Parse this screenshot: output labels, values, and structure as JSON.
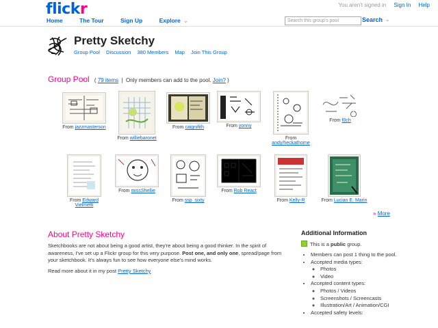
{
  "brand": {
    "part1": "flick",
    "part2": "r"
  },
  "topbar": {
    "status": "You aren't signed in",
    "sign_in": "Sign In",
    "help": "Help"
  },
  "nav": {
    "home": "Home",
    "tour": "The Tour",
    "signup": "Sign Up",
    "explore": "Explore"
  },
  "search": {
    "placeholder": "Search this group's pool",
    "button": "Search"
  },
  "group": {
    "title": "Pretty Sketchy",
    "tabs": [
      "Group Pool",
      "Discussion",
      "380 Members",
      "Map",
      "Join This Group"
    ]
  },
  "pool": {
    "title": "Group Pool",
    "items_link": "79 items",
    "note": "Only members can add to the pool.",
    "join_link": "Join?",
    "from_label": "From",
    "thumbs": [
      {
        "name": "jazzmasterson"
      },
      {
        "name": "williebaronet"
      },
      {
        "name": "caignifith"
      },
      {
        "name": "yonny"
      },
      {
        "name": "andy/heckathorne"
      },
      {
        "name": "f0ch"
      },
      {
        "name": "Edward Vielmetti"
      },
      {
        "name": "missShellie"
      },
      {
        "name": "ssp_sixty"
      },
      {
        "name": "Rob React"
      },
      {
        "name": "Kelly-R"
      },
      {
        "name": "Lucian E. Marin"
      }
    ],
    "more": "More"
  },
  "about": {
    "title": "About Pretty Sketchy",
    "p1_a": "Sketchbooks are not about being a good artist, they're about being a good thinker. In the spirit of awareness, I've set up a Flickr group for this very purpose. ",
    "p1_bold": "Post one, and only one",
    "p1_b": ", spread/page from your sketchbook. It's always fun to see how everyone else's mind works.",
    "p2_a": "Read more about it in my post ",
    "p2_link": "Pretty Sketchy"
  },
  "info": {
    "title": "Additional Information",
    "public_a": "This is a ",
    "public_bold": "public",
    "public_b": " group.",
    "rule1": "Members can post 1 thing to the pool.",
    "media_label": "Accepted media types:",
    "media": [
      "Photos",
      "Video"
    ],
    "content_label": "Accepted content types:",
    "content": [
      "Photos / Videos",
      "Screenshots / Screencasts",
      "Illustration/Art / Animation/CGI"
    ],
    "safety_label": "Accepted safety levels:"
  },
  "colors": {
    "blue": "#0063dc",
    "pink": "#ff0084",
    "public_green": "#99cc33"
  },
  "icons": {
    "group": "scribble-avatar-icon",
    "more": "double-chevron-right-icon",
    "public": "green-square-icon"
  }
}
